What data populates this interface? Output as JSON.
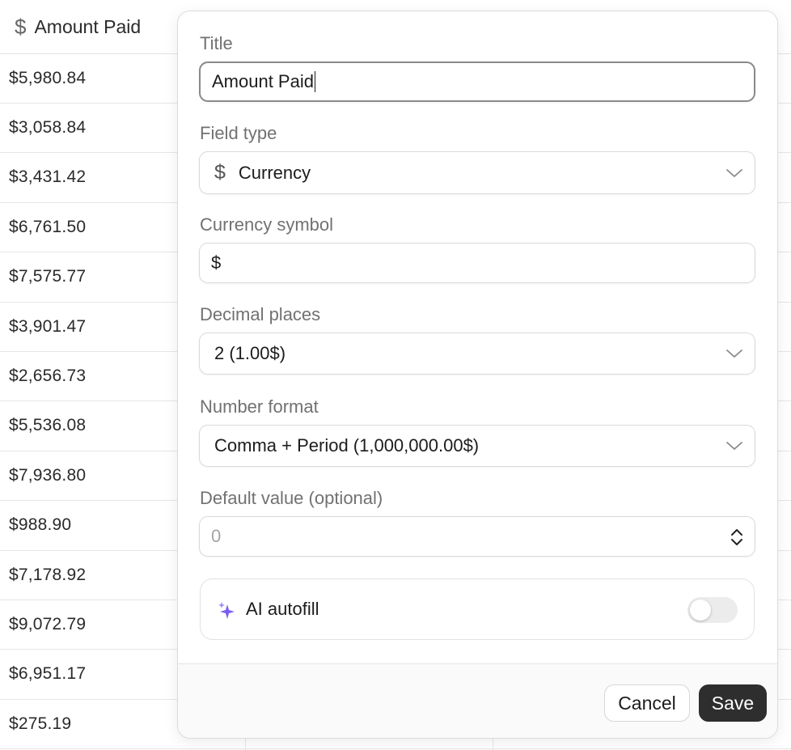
{
  "table": {
    "column_title": "Amount Paid",
    "column_icon": "dollar-icon",
    "rows": [
      "$5,980.84",
      "$3,058.84",
      "$3,431.42",
      "$6,761.50",
      "$7,575.77",
      "$3,901.47",
      "$2,656.73",
      "$5,536.08",
      "$7,936.80",
      "$988.90",
      "$7,178.92",
      "$9,072.79",
      "$6,951.17",
      "$275.19"
    ]
  },
  "popover": {
    "title_label": "Title",
    "title_value": "Amount Paid",
    "field_type_label": "Field type",
    "field_type_value": "Currency",
    "field_type_icon": "dollar-icon",
    "currency_symbol_label": "Currency symbol",
    "currency_symbol_value": "$",
    "decimal_places_label": "Decimal places",
    "decimal_places_value": "2 (1.00$)",
    "number_format_label": "Number format",
    "number_format_value": "Comma + Period (1,000,000.00$)",
    "default_value_label": "Default value (optional)",
    "default_value_placeholder": "0",
    "ai_autofill_label": "AI autofill",
    "ai_autofill_enabled": false,
    "cancel_label": "Cancel",
    "save_label": "Save"
  },
  "colors": {
    "accent_ai": "#7b5cf0",
    "save_button_bg": "#2e2e2e"
  }
}
